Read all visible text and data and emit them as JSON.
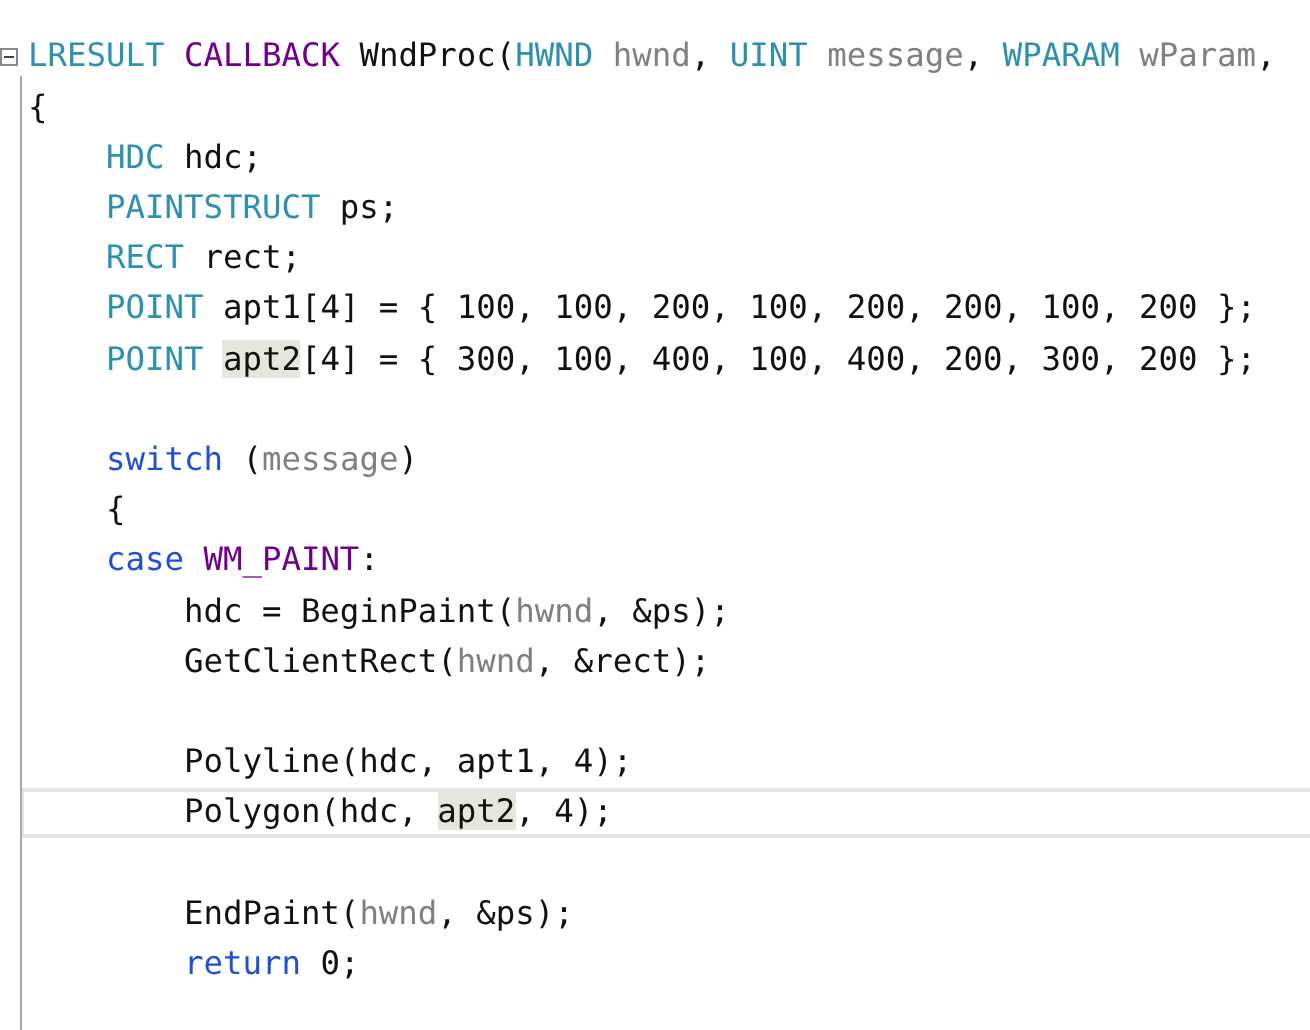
{
  "editor": {
    "lines": [
      {
        "kind": "code",
        "current": false,
        "collapsible": true,
        "tokens": [
          {
            "text": "LRESULT",
            "kind": "type"
          },
          {
            "text": " CALLBACK",
            "kind": "macro"
          },
          {
            "text": " WndProc(",
            "kind": "plain"
          },
          {
            "text": "HWND",
            "kind": "type"
          },
          {
            "text": " hwnd",
            "kind": "param"
          },
          {
            "text": ", ",
            "kind": "plain"
          },
          {
            "text": "UINT",
            "kind": "type"
          },
          {
            "text": " message",
            "kind": "param"
          },
          {
            "text": ", ",
            "kind": "plain"
          },
          {
            "text": "WPARAM",
            "kind": "type"
          },
          {
            "text": " wParam",
            "kind": "param"
          },
          {
            "text": ",",
            "kind": "plain"
          }
        ]
      },
      {
        "kind": "code",
        "current": false,
        "collapsible": false,
        "tokens": [
          {
            "text": "{",
            "kind": "plain"
          }
        ]
      },
      {
        "kind": "code",
        "current": false,
        "collapsible": false,
        "tokens": [
          {
            "text": "    HDC",
            "kind": "type"
          },
          {
            "text": " hdc;",
            "kind": "plain"
          }
        ]
      },
      {
        "kind": "code",
        "current": false,
        "collapsible": false,
        "tokens": [
          {
            "text": "    PAINTSTRUCT",
            "kind": "type"
          },
          {
            "text": " ps;",
            "kind": "plain"
          }
        ]
      },
      {
        "kind": "code",
        "current": false,
        "collapsible": false,
        "tokens": [
          {
            "text": "    RECT",
            "kind": "type"
          },
          {
            "text": " rect;",
            "kind": "plain"
          }
        ]
      },
      {
        "kind": "code",
        "current": false,
        "collapsible": false,
        "tokens": [
          {
            "text": "    POINT",
            "kind": "type"
          },
          {
            "text": " apt1[4] = { 100, 100, 200, 100, 200, 200, 100, 200 };",
            "kind": "plain"
          }
        ]
      },
      {
        "kind": "code",
        "current": false,
        "collapsible": false,
        "tokens": [
          {
            "text": "    POINT ",
            "kind": "type"
          },
          {
            "text": "apt2",
            "kind": "plain",
            "highlighted": true
          },
          {
            "text": "[4] = { 300, 100, 400, 100, 400, 200, 300, 200 };",
            "kind": "plain"
          }
        ]
      },
      {
        "kind": "blank",
        "current": false,
        "collapsible": false
      },
      {
        "kind": "code",
        "current": false,
        "collapsible": false,
        "tokens": [
          {
            "text": "    switch",
            "kind": "keyword"
          },
          {
            "text": " (",
            "kind": "plain"
          },
          {
            "text": "message",
            "kind": "param"
          },
          {
            "text": ")",
            "kind": "plain"
          }
        ]
      },
      {
        "kind": "code",
        "current": false,
        "collapsible": false,
        "tokens": [
          {
            "text": "    {",
            "kind": "plain"
          }
        ]
      },
      {
        "kind": "code",
        "current": false,
        "collapsible": false,
        "tokens": [
          {
            "text": "    case",
            "kind": "keyword"
          },
          {
            "text": " WM_PAINT",
            "kind": "macro"
          },
          {
            "text": ":",
            "kind": "plain"
          }
        ]
      },
      {
        "kind": "code",
        "current": false,
        "collapsible": false,
        "tokens": [
          {
            "text": "        hdc = BeginPaint(",
            "kind": "plain"
          },
          {
            "text": "hwnd",
            "kind": "param"
          },
          {
            "text": ", &ps);",
            "kind": "plain"
          }
        ]
      },
      {
        "kind": "code",
        "current": false,
        "collapsible": false,
        "tokens": [
          {
            "text": "        GetClientRect(",
            "kind": "plain"
          },
          {
            "text": "hwnd",
            "kind": "param"
          },
          {
            "text": ", &rect);",
            "kind": "plain"
          }
        ]
      },
      {
        "kind": "blank",
        "current": false,
        "collapsible": false
      },
      {
        "kind": "code",
        "current": false,
        "collapsible": false,
        "tokens": [
          {
            "text": "        Polyline(hdc, apt1, 4);",
            "kind": "plain"
          }
        ]
      },
      {
        "kind": "code",
        "current": true,
        "collapsible": false,
        "tokens": [
          {
            "text": "        Polygon(hdc, ",
            "kind": "plain"
          },
          {
            "text": "apt2",
            "kind": "plain",
            "highlighted": true
          },
          {
            "text": ", 4);",
            "kind": "plain"
          }
        ]
      },
      {
        "kind": "blank",
        "current": false,
        "collapsible": false
      },
      {
        "kind": "code",
        "current": false,
        "collapsible": false,
        "tokens": [
          {
            "text": "        EndPaint(",
            "kind": "plain"
          },
          {
            "text": "hwnd",
            "kind": "param"
          },
          {
            "text": ", &ps);",
            "kind": "plain"
          }
        ]
      },
      {
        "kind": "code",
        "current": false,
        "collapsible": false,
        "tokens": [
          {
            "text": "        return",
            "kind": "keyword"
          },
          {
            "text": " 0;",
            "kind": "plain"
          }
        ]
      }
    ]
  }
}
